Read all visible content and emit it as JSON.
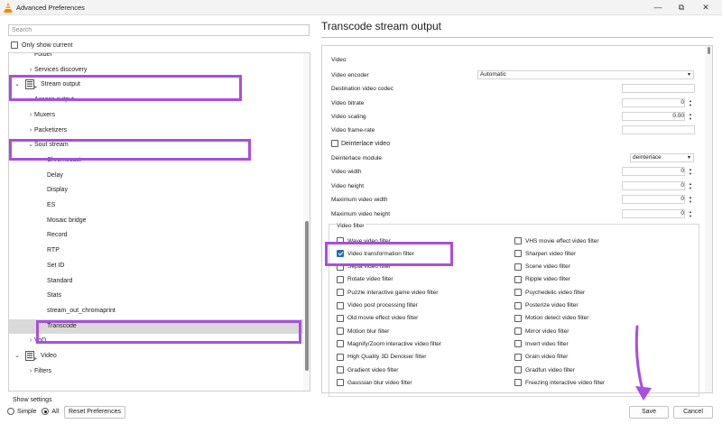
{
  "window": {
    "title": "Advanced Preferences",
    "min_glyph": "—",
    "max_glyph": "⧉",
    "close_glyph": "✕"
  },
  "left": {
    "search_placeholder": "Search",
    "only_show_current": "Only show current",
    "tree": [
      {
        "label": "Folder",
        "indent": 1,
        "chevron": ""
      },
      {
        "label": "Services discovery",
        "indent": 1,
        "chevron": "right"
      },
      {
        "label": "Stream output",
        "indent": 0,
        "chevron": "down",
        "icon": "stream-output-icon"
      },
      {
        "label": "Access output",
        "indent": 1,
        "chevron": "right"
      },
      {
        "label": "Muxers",
        "indent": 1,
        "chevron": "right"
      },
      {
        "label": "Packetizers",
        "indent": 1,
        "chevron": "right"
      },
      {
        "label": "Sout stream",
        "indent": 1,
        "chevron": "down"
      },
      {
        "label": "Chromecast",
        "indent": 2,
        "chevron": ""
      },
      {
        "label": "Delay",
        "indent": 2,
        "chevron": ""
      },
      {
        "label": "Display",
        "indent": 2,
        "chevron": ""
      },
      {
        "label": "ES",
        "indent": 2,
        "chevron": ""
      },
      {
        "label": "Mosaic bridge",
        "indent": 2,
        "chevron": ""
      },
      {
        "label": "Record",
        "indent": 2,
        "chevron": ""
      },
      {
        "label": "RTP",
        "indent": 2,
        "chevron": ""
      },
      {
        "label": "Set ID",
        "indent": 2,
        "chevron": ""
      },
      {
        "label": "Standard",
        "indent": 2,
        "chevron": ""
      },
      {
        "label": "Stats",
        "indent": 2,
        "chevron": ""
      },
      {
        "label": "stream_out_chromaprint",
        "indent": 2,
        "chevron": ""
      },
      {
        "label": "Transcode",
        "indent": 2,
        "chevron": "",
        "selected": true
      },
      {
        "label": "VoD",
        "indent": 1,
        "chevron": "right"
      },
      {
        "label": "Video",
        "indent": 0,
        "chevron": "down",
        "icon": "video-icon"
      },
      {
        "label": "Filters",
        "indent": 1,
        "chevron": "right"
      }
    ],
    "show_settings": "Show settings",
    "simple": "Simple",
    "all": "All",
    "reset": "Reset Preferences"
  },
  "right": {
    "title": "Transcode stream output",
    "video_group": "Video",
    "video_encoder_label": "Video encoder",
    "video_encoder_value": "Automatic",
    "destination_codec_label": "Destination video codec",
    "video_bitrate_label": "Video bitrate",
    "video_bitrate_value": "0",
    "video_scaling_label": "Video scaling",
    "video_scaling_value": "0.00",
    "video_framerate_label": "Video frame-rate",
    "deinterlace_video_label": "Deinterlace video",
    "deinterlace_module_label": "Deinterlace module",
    "deinterlace_module_value": "deinterlace",
    "video_width_label": "Video width",
    "video_width_value": "0",
    "video_height_label": "Video height",
    "video_height_value": "0",
    "max_width_label": "Maximum video width",
    "max_width_value": "0",
    "max_height_label": "Maximum video height",
    "max_height_value": "0",
    "video_filter_group": "Video filter",
    "filters_left": [
      {
        "label": "Wave video filter",
        "checked": false
      },
      {
        "label": "Video transformation filter",
        "checked": true
      },
      {
        "label": "Sepia video filter",
        "checked": false
      },
      {
        "label": "Rotate video filter",
        "checked": false
      },
      {
        "label": "Puzzle interactive game video filter",
        "checked": false
      },
      {
        "label": "Video post processing filter",
        "checked": false
      },
      {
        "label": "Old movie effect video filter",
        "checked": false
      },
      {
        "label": "Motion blur filter",
        "checked": false
      },
      {
        "label": "Magnify/Zoom interactive video filter",
        "checked": false
      },
      {
        "label": "High Quality 3D Denoiser filter",
        "checked": false
      },
      {
        "label": "Gradient video filter",
        "checked": false
      },
      {
        "label": "Gaussian blur video filter",
        "checked": false
      }
    ],
    "filters_right": [
      {
        "label": "VHS movie effect video filter",
        "checked": false
      },
      {
        "label": "Sharpen video filter",
        "checked": false
      },
      {
        "label": "Scene video filter",
        "checked": false
      },
      {
        "label": "Ripple video filter",
        "checked": false
      },
      {
        "label": "Psychedelic video filter",
        "checked": false
      },
      {
        "label": "Posterize video filter",
        "checked": false
      },
      {
        "label": "Motion detect video filter",
        "checked": false
      },
      {
        "label": "Mirror video filter",
        "checked": false
      },
      {
        "label": "Invert video filter",
        "checked": false
      },
      {
        "label": "Grain video filter",
        "checked": false
      },
      {
        "label": "Gradfun video filter",
        "checked": false
      },
      {
        "label": "Freezing interactive video filter",
        "checked": false
      }
    ]
  },
  "buttons": {
    "save": "Save",
    "cancel": "Cancel"
  },
  "colors": {
    "highlight": "#a94ee0",
    "accent": "#1f6fb5",
    "selected_row": "#d9d9d9"
  }
}
